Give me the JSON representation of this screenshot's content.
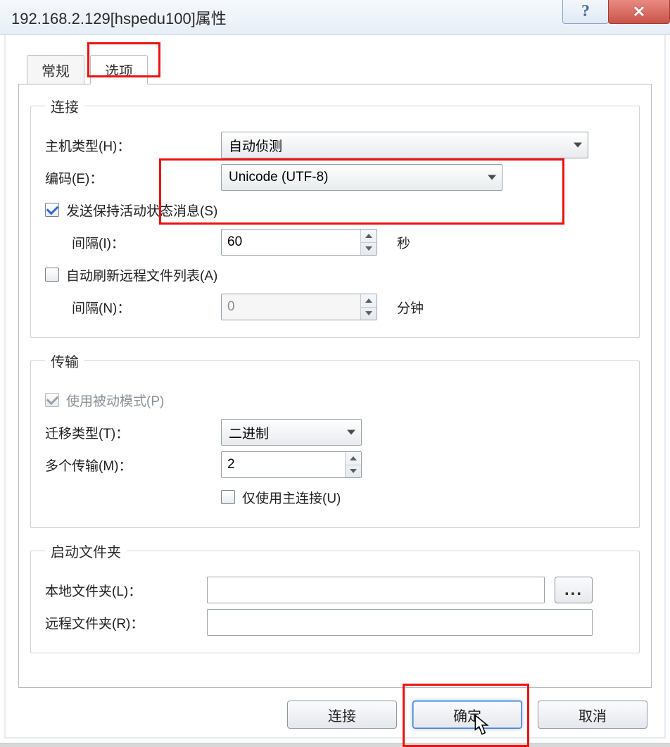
{
  "window": {
    "title": "192.168.2.129[hspedu100]属性"
  },
  "tabs": {
    "general": "常规",
    "options": "选项"
  },
  "groups": {
    "connection": {
      "legend": "连接",
      "host_type_label": "主机类型(H)：",
      "host_type_value": "自动侦测",
      "encoding_label": "编码(E)：",
      "encoding_value": "Unicode (UTF-8)",
      "keepalive_label": "发送保持活动状态消息(S)",
      "keepalive_interval_label": "间隔(I)：",
      "keepalive_interval_value": "60",
      "keepalive_unit": "秒",
      "autorefresh_label": "自动刷新远程文件列表(A)",
      "autorefresh_interval_label": "间隔(N)：",
      "autorefresh_interval_value": "0",
      "autorefresh_unit": "分钟"
    },
    "transfer": {
      "legend": "传输",
      "passive_label": "使用被动模式(P)",
      "transfer_type_label": "迁移类型(T)：",
      "transfer_type_value": "二进制",
      "multi_label": "多个传输(M)：",
      "multi_value": "2",
      "main_only_label": "仅使用主连接(U)"
    },
    "startup": {
      "legend": "启动文件夹",
      "local_label": "本地文件夹(L)：",
      "local_value": "",
      "remote_label": "远程文件夹(R)：",
      "remote_value": "",
      "browse_label": "..."
    }
  },
  "buttons": {
    "connect": "连接",
    "ok": "确定",
    "cancel": "取消"
  }
}
